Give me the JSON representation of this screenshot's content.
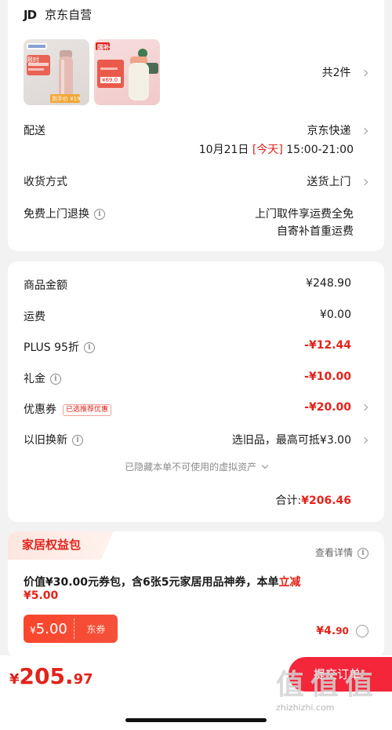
{
  "shop": {
    "logo": "JD",
    "name": "京东自营"
  },
  "products": {
    "count_prefix": "共",
    "count": "2",
    "count_suffix": "件",
    "thumb1_badge": "限时",
    "thumb1_price": "到手价 ¥19",
    "thumb2_badge": "国补",
    "thumb2_price": "¥69.0"
  },
  "delivery": {
    "label": "配送",
    "method": "京东快递",
    "date": "10月21日",
    "today": "[今天]",
    "time": "15:00-21:00"
  },
  "receive": {
    "label": "收货方式",
    "value": "送货上门"
  },
  "return": {
    "label": "免费上门退换",
    "line1": "上门取件享运费全免",
    "line2": "自寄补首重运费"
  },
  "summary": {
    "items": [
      {
        "label": "商品金额",
        "value": "¥248.90",
        "red": false,
        "chevron": false,
        "info": false
      },
      {
        "label": "运费",
        "value": "¥0.00",
        "red": false,
        "chevron": false,
        "info": false
      },
      {
        "label": "PLUS 95折",
        "value": "-¥12.44",
        "red": true,
        "chevron": false,
        "info": true
      },
      {
        "label": "礼金",
        "value": "-¥10.00",
        "red": true,
        "chevron": false,
        "info": true
      },
      {
        "label": "优惠券",
        "value": "-¥20.00",
        "red": true,
        "chevron": true,
        "info": false,
        "badge": "已选推荐优惠"
      },
      {
        "label": "以旧换新",
        "value": "选旧品，最高可抵¥3.00",
        "red": false,
        "chevron": true,
        "info": true
      }
    ],
    "hidden_note": "已隐藏本单不可使用的虚拟资产",
    "total_label": "合计:",
    "total_value": "¥206.46"
  },
  "bundle": {
    "title": "家居权益包",
    "details": "查看详情",
    "desc_main": "价值¥30.00元券包，含6张5元家居用品神券，本单",
    "desc_highlight": "立减",
    "desc_line2": "¥5.00",
    "coupon_currency": "¥",
    "coupon_amount": "5.00",
    "coupon_type": "东券",
    "price_main": "¥4.",
    "price_dec": "90"
  },
  "footer": {
    "currency": "¥",
    "amount": "205.",
    "amount_dec": "97",
    "submit": "提交订单",
    "watermark": "zhizhizhi.com"
  },
  "colors": {
    "accent": "#e2231a",
    "button": "#f3263a",
    "background": "#f2f2f2"
  }
}
